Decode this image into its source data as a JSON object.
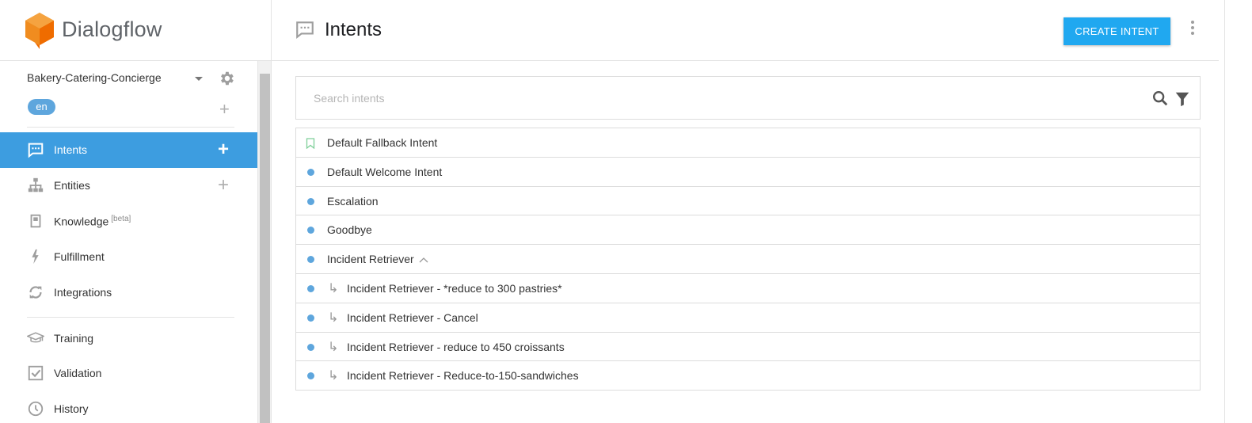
{
  "brand": {
    "name": "Dialogflow"
  },
  "agent": {
    "name": "Bakery-Catering-Concierge",
    "language": "en"
  },
  "nav": [
    {
      "label": "Intents",
      "icon": "intents-icon",
      "active": true,
      "has_add": true
    },
    {
      "label": "Entities",
      "icon": "entities-icon",
      "active": false,
      "has_add": true
    },
    {
      "label": "Knowledge",
      "suffix": "[beta]",
      "icon": "knowledge-icon",
      "active": false,
      "has_add": false
    },
    {
      "label": "Fulfillment",
      "icon": "fulfillment-icon",
      "active": false,
      "has_add": false
    },
    {
      "label": "Integrations",
      "icon": "integrations-icon",
      "active": false,
      "has_add": false
    },
    {
      "label": "Training",
      "icon": "training-icon",
      "active": false,
      "has_add": false
    },
    {
      "label": "Validation",
      "icon": "validation-icon",
      "active": false,
      "has_add": false
    },
    {
      "label": "History",
      "icon": "history-icon",
      "active": false,
      "has_add": false
    }
  ],
  "header": {
    "title": "Intents",
    "create_label": "CREATE INTENT"
  },
  "search": {
    "placeholder": "Search intents",
    "value": ""
  },
  "intents": [
    {
      "name": "Default Fallback Intent",
      "marker": "bookmark",
      "child": false
    },
    {
      "name": "Default Welcome Intent",
      "marker": "dot",
      "child": false
    },
    {
      "name": "Escalation",
      "marker": "dot",
      "child": false
    },
    {
      "name": "Goodbye",
      "marker": "dot",
      "child": false
    },
    {
      "name": "Incident Retriever",
      "marker": "dot",
      "child": false,
      "expanded": true
    },
    {
      "name": "Incident Retriever - *reduce to 300 pastries*",
      "marker": "dot",
      "child": true
    },
    {
      "name": "Incident Retriever - Cancel",
      "marker": "dot",
      "child": true
    },
    {
      "name": "Incident Retriever - reduce to 450 croissants",
      "marker": "dot",
      "child": true
    },
    {
      "name": "Incident Retriever - Reduce-to-150-sandwiches",
      "marker": "dot",
      "child": true
    }
  ],
  "colors": {
    "accent": "#3d9de0",
    "button": "#20a8f0",
    "dot": "#5ea6dd",
    "logo": "#f08c1f"
  }
}
